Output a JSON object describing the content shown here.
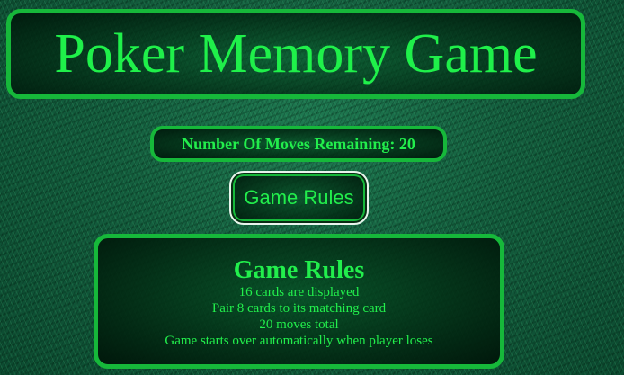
{
  "header": {
    "title": "Poker Memory Game"
  },
  "status": {
    "moves_label": "Number Of Moves Remaining:",
    "moves_remaining": "20"
  },
  "rules_button": {
    "label": "Game Rules"
  },
  "rules_panel": {
    "heading": "Game Rules",
    "items": [
      "16 cards are displayed",
      "Pair 8 cards to its matching card",
      "20 moves total",
      "Game starts over automatically when player loses"
    ]
  },
  "colors": {
    "accent_green": "#22ee4c",
    "border_green": "#16b83a",
    "felt_green": "#145e3e"
  }
}
